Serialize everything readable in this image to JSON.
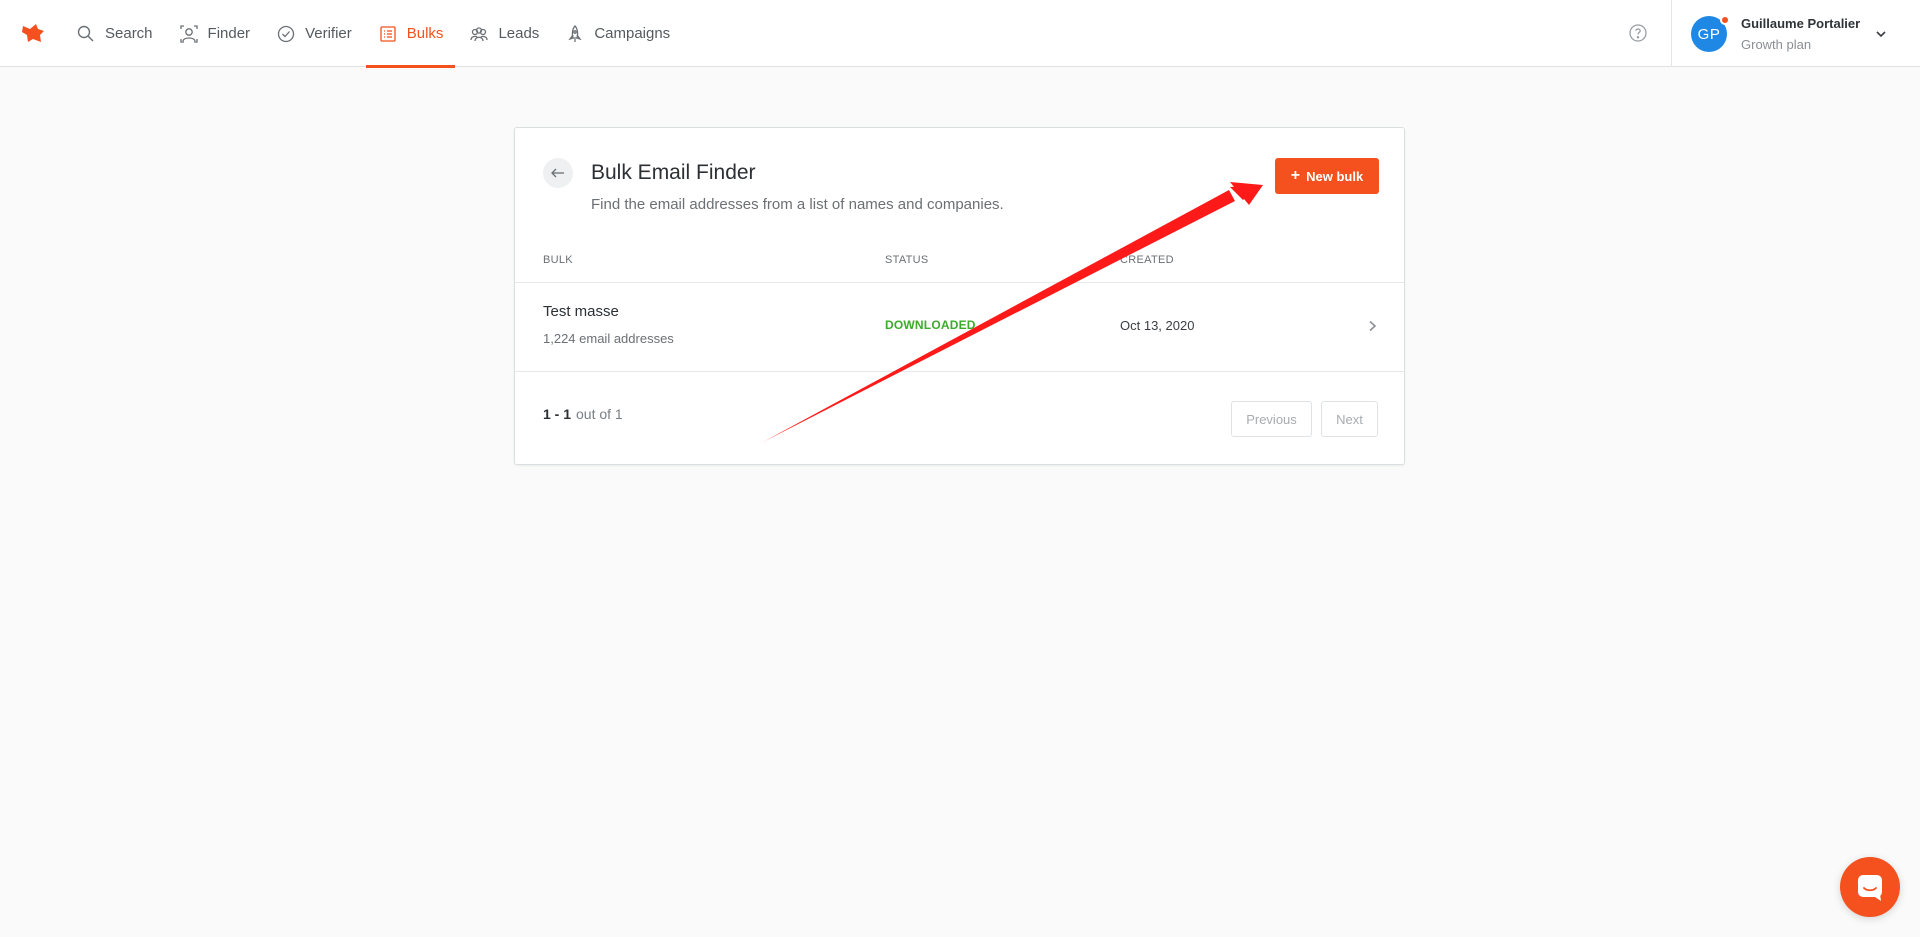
{
  "nav": {
    "items": [
      {
        "label": "Search",
        "icon": "search-icon"
      },
      {
        "label": "Finder",
        "icon": "finder-icon"
      },
      {
        "label": "Verifier",
        "icon": "verifier-icon"
      },
      {
        "label": "Bulks",
        "icon": "bulks-icon",
        "active": true
      },
      {
        "label": "Leads",
        "icon": "leads-icon"
      },
      {
        "label": "Campaigns",
        "icon": "rocket-icon"
      }
    ]
  },
  "user": {
    "initials": "GP",
    "name": "Guillaume Portalier",
    "plan": "Growth plan"
  },
  "card": {
    "title": "Bulk Email Finder",
    "subtitle": "Find the email addresses from a list of names and companies.",
    "new_button": "New bulk",
    "columns": {
      "bulk": "BULK",
      "status": "STATUS",
      "created": "CREATED"
    },
    "rows": [
      {
        "name": "Test masse",
        "count": "1,224 email addresses",
        "status": "DOWNLOADED",
        "created": "Oct 13, 2020"
      }
    ],
    "pagination": {
      "range": "1 - 1",
      "total": "out of 1",
      "previous": "Previous",
      "next": "Next"
    }
  },
  "colors": {
    "accent": "#f4511e",
    "status_success": "#3cab2c",
    "avatar": "#1f88e5",
    "annotation_arrow": "#ff0000"
  }
}
